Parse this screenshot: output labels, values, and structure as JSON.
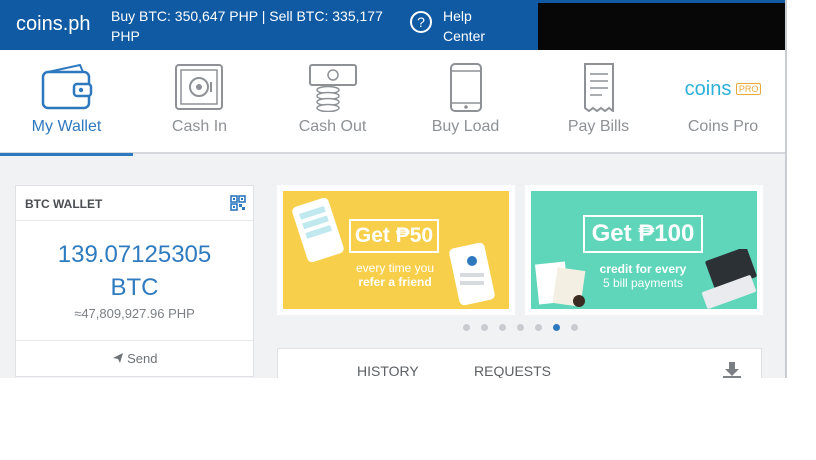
{
  "header": {
    "logo": "coins.ph",
    "rates_line": "Buy BTC: 350,647 PHP | Sell BTC: 335,177 PHP",
    "help_icon": "?",
    "help_label": "Help Center"
  },
  "nav": {
    "items": [
      {
        "label": "My Wallet",
        "icon": "wallet-icon",
        "active": true
      },
      {
        "label": "Cash In",
        "icon": "safe-icon"
      },
      {
        "label": "Cash Out",
        "icon": "cash-out-icon"
      },
      {
        "label": "Buy Load",
        "icon": "phone-icon"
      },
      {
        "label": "Pay Bills",
        "icon": "bill-icon"
      },
      {
        "label": "Coins Pro",
        "icon": "coins-pro-logo",
        "logo_text": "coins",
        "logo_badge": "PRO"
      }
    ]
  },
  "wallet": {
    "title": "BTC WALLET",
    "amount": "139.07125305",
    "unit": "BTC",
    "fiat": "≈47,809,927.96 PHP",
    "send_label": "Send"
  },
  "banners": [
    {
      "headline": "Get ₱50",
      "sub1": "every time you",
      "sub2": "refer a friend",
      "color": "#f8cf4a"
    },
    {
      "headline": "Get ₱100",
      "sub1": "credit for every",
      "sub2": "5 bill payments",
      "color": "#5fd6ba"
    }
  ],
  "carousel": {
    "count": 7,
    "active_index": 5
  },
  "history": {
    "tabs": [
      "HISTORY",
      "REQUESTS"
    ],
    "download_icon": "download-icon"
  },
  "colors": {
    "brand": "#0f5aa3",
    "accent": "#2e78bf"
  }
}
